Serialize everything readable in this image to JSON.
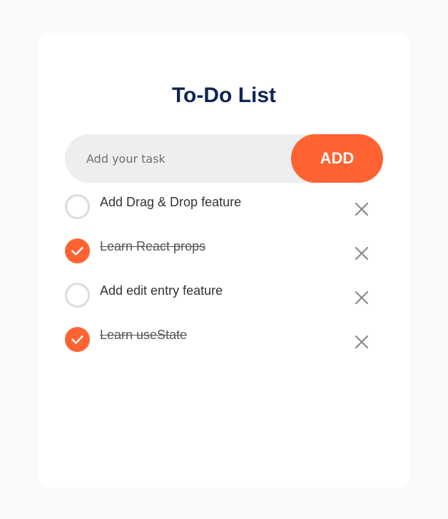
{
  "header": {
    "title": "To-Do List"
  },
  "input": {
    "placeholder": "Add your task",
    "value": ""
  },
  "add_button": {
    "label": "ADD"
  },
  "tasks": [
    {
      "text": "Add Drag & Drop feature",
      "checked": false
    },
    {
      "text": "Learn React props",
      "checked": true
    },
    {
      "text": "Add edit entry feature",
      "checked": false
    },
    {
      "text": "Learn useState",
      "checked": true
    }
  ],
  "icons": {
    "check": "check-icon",
    "remove": "close-icon"
  },
  "colors": {
    "accent": "#ff6332",
    "title": "#0e2553",
    "input_bg": "#edeef0",
    "page_bg": "#f8f9fb"
  }
}
